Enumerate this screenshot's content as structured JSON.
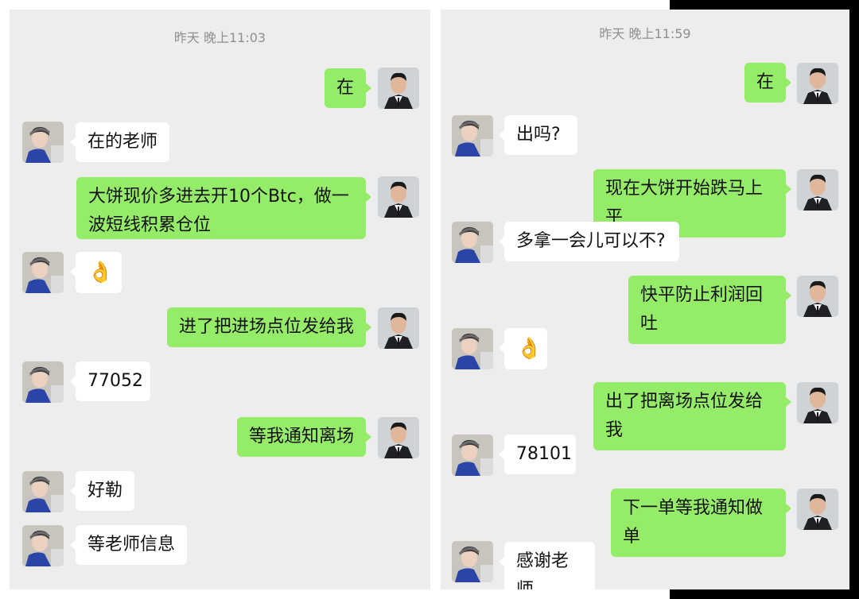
{
  "colors": {
    "bubble_sent": "#95ec69",
    "bubble_received": "#ffffff",
    "panel_bg": "#ededed"
  },
  "left_panel": {
    "timestamp": "昨天 晚上11:03",
    "messages": [
      {
        "from": "me",
        "text": "在"
      },
      {
        "from": "other",
        "text": "在的老师"
      },
      {
        "from": "me",
        "text": "大饼现价多进去开10个Btc，做一波短线积累仓位"
      },
      {
        "from": "other",
        "text": "👌"
      },
      {
        "from": "me",
        "text": "进了把进场点位发给我"
      },
      {
        "from": "other",
        "text": "77052"
      },
      {
        "from": "me",
        "text": "等我通知离场"
      },
      {
        "from": "other",
        "text": "好勒"
      },
      {
        "from": "other",
        "text": "等老师信息"
      }
    ]
  },
  "right_panel": {
    "timestamp": "昨天 晚上11:59",
    "messages": [
      {
        "from": "me",
        "text": "在"
      },
      {
        "from": "other",
        "text": "出吗?"
      },
      {
        "from": "me",
        "text": "现在大饼开始跌马上平"
      },
      {
        "from": "other",
        "text": "多拿一会儿可以不?"
      },
      {
        "from": "me",
        "text": "快平防止利润回吐"
      },
      {
        "from": "other",
        "text": "👌"
      },
      {
        "from": "me",
        "text": "出了把离场点位发给我"
      },
      {
        "from": "other",
        "text": "78101"
      },
      {
        "from": "me",
        "text": "下一单等我通知做单"
      },
      {
        "from": "other",
        "text": "感谢老师"
      }
    ]
  }
}
